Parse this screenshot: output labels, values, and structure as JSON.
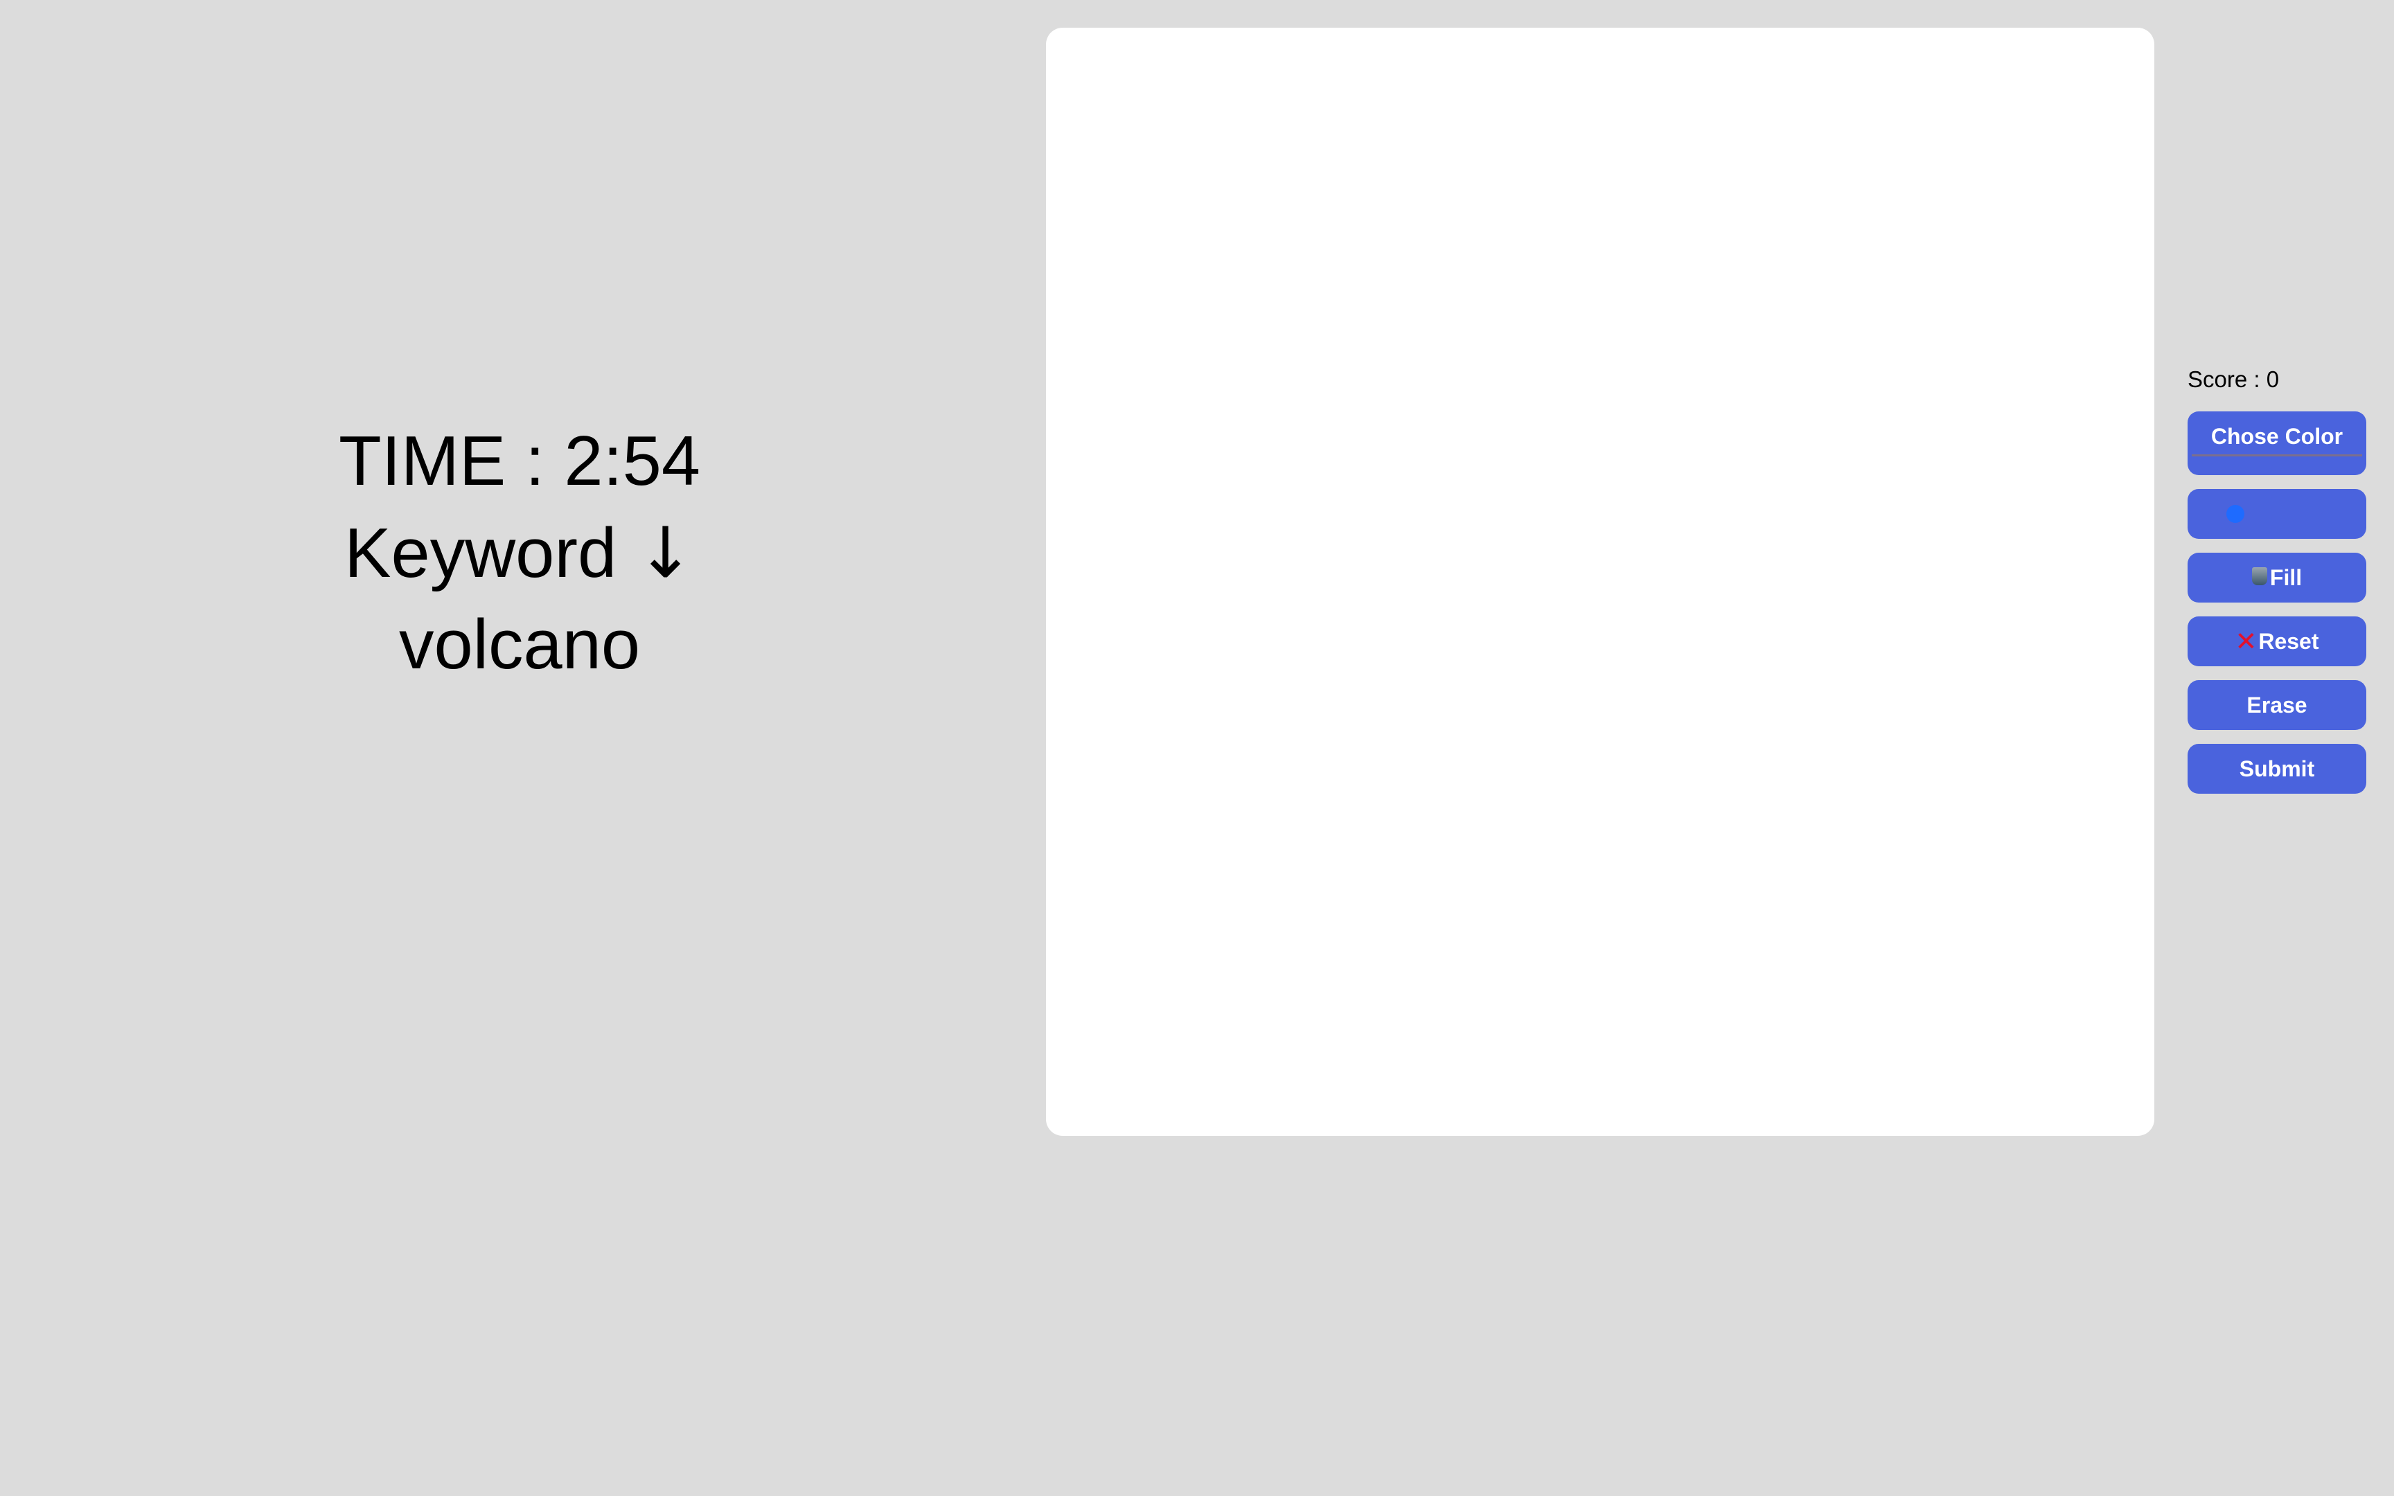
{
  "game": {
    "time_label": "TIME : 2:54",
    "keyword_label": "Keyword",
    "keyword_arrow": "↓",
    "keyword_value": "volcano"
  },
  "sidebar": {
    "score_label": "Score : 0",
    "chose_color_label": "Chose Color",
    "selected_color": "#1e6bff",
    "fill_label": "Fill",
    "reset_label": "Reset",
    "reset_icon": "✕",
    "erase_label": "Erase",
    "submit_label": "Submit"
  },
  "colors": {
    "background": "#dcdcdc",
    "canvas": "#ffffff",
    "button": "#4a63dd",
    "reset_icon": "#e3102c"
  }
}
